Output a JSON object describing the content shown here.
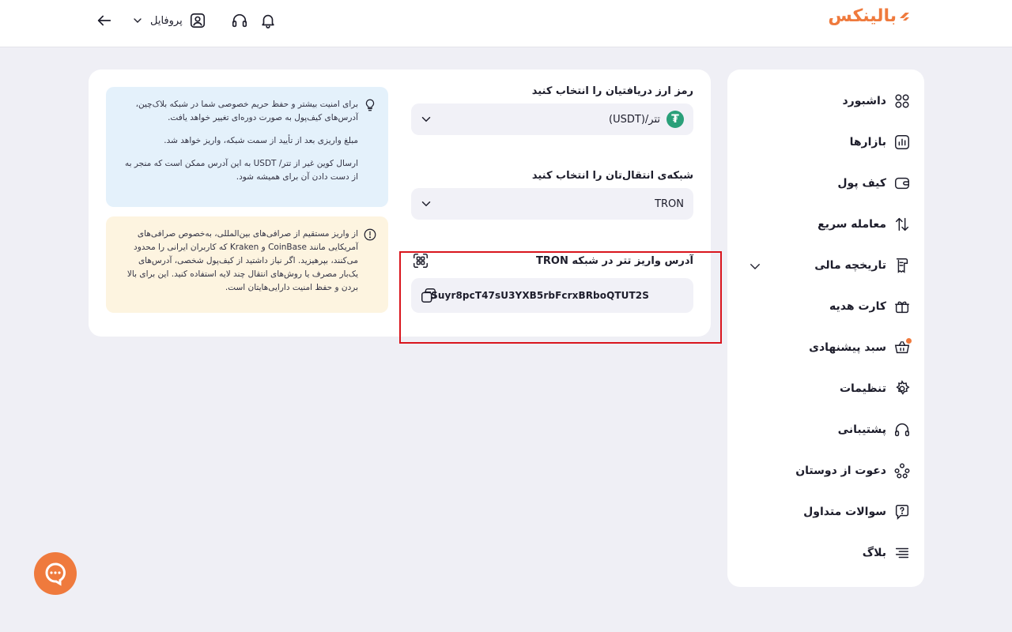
{
  "header": {
    "logo_text": "بالینکس",
    "profile_label": "پروفایل"
  },
  "sidebar": {
    "items": [
      {
        "label": "داشبورد",
        "icon": "grid-icon"
      },
      {
        "label": "بازارها",
        "icon": "chart-icon"
      },
      {
        "label": "کیف پول",
        "icon": "wallet-icon"
      },
      {
        "label": "معامله سریع",
        "icon": "swap-icon"
      },
      {
        "label": "تاریخچه مالی",
        "icon": "receipt-icon"
      },
      {
        "label": "کارت هدیه",
        "icon": "gift-icon"
      },
      {
        "label": "سبد پیشنهادی",
        "icon": "basket-icon"
      },
      {
        "label": "تنظیمات",
        "icon": "gear-icon"
      },
      {
        "label": "پشتیبانی",
        "icon": "headset-icon"
      },
      {
        "label": "دعوت از دوستان",
        "icon": "users-icon"
      },
      {
        "label": "سوالات متداول",
        "icon": "faq-icon"
      },
      {
        "label": "بلاگ",
        "icon": "menu-lines-icon"
      }
    ]
  },
  "form": {
    "currency_label": "رمز ارز دریافتیان را انتخاب کنید",
    "currency_value": "تتر/(USDT)",
    "network_label": "شبکه‌ی انتقال‌تان را انتخاب کنید",
    "network_value": "TRON",
    "address_title": "آدرس واریز تتر در شبکه TRON",
    "address_value": "TSuyr8pcT47sU3YXB5rbFcrxBRboQTUT2S"
  },
  "notices": {
    "info_p1": "برای امنیت بیشتر و حفظ حریم خصوصی شما در شبکه بلاک‌چین، آدرس‌های کیف‌پول به صورت دوره‌ای تغییر خواهد یافت.",
    "info_p2": "مبلغ واریزی بعد از تأیید از سمت شبکه، واریز خواهد شد.",
    "info_p3": "ارسال کوین غیر از تتر/ USDT به این آدرس ممکن است که منجر به از دست دادن آن برای همیشه شود.",
    "warn_p1": "از واریز مستقیم از صرافی‌های بین‌المللی، به‌خصوص صرافی‌های آمریکایی مانند CoinBase و Kraken که کاربران ایرانی را محدود می‌کنند، بپرهیزید. اگر نیاز داشتید از کیف‌پول شخصی، آدرس‌های یک‌بار مصرف یا روش‌های انتقال چند لایه استفاده کنید. این برای بالا بردن و حفظ امنیت دارایی‌هایتان است."
  },
  "colors": {
    "accent": "#ef7a3d",
    "highlight": "#d9151d",
    "tether": "#2aa079"
  }
}
